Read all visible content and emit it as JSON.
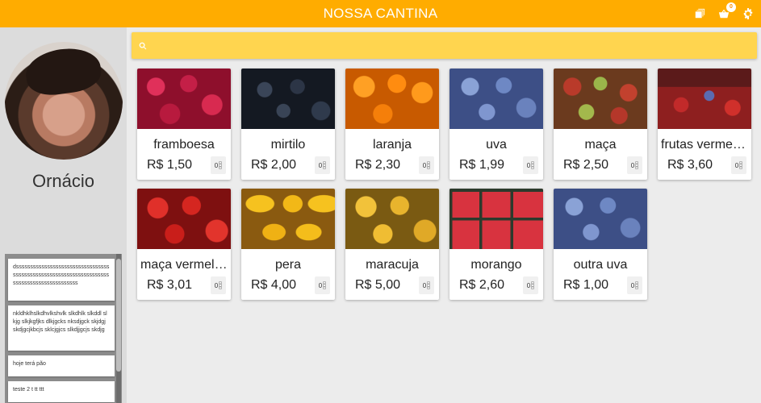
{
  "header": {
    "title": "NOSSA CANTINA",
    "cart_count": "0",
    "icons": [
      "history-icon",
      "cart-icon",
      "settings-icon"
    ]
  },
  "sidebar": {
    "user_name": "Ornácio",
    "notes": [
      "dssssssssssssssssssssssssssssssssssssssssssssssssssssssssssssssssssssssssssssssssssssssssss",
      "nkldhklhslkdhvlkshvlk slkdhlk slkddl slkjg slkjkgfjks dlkjgcks nksdjgck skjdgj skdjgcjkbcjs sklcjgjcs slkdjjgcjs skdjg",
      "hoje terá pão",
      "teste 2 t tt ttt"
    ]
  },
  "search": {
    "placeholder": "",
    "value": ""
  },
  "colors": {
    "header": "#ffac00",
    "search_bar": "#ffd54f",
    "sidebar": "#dcdcdc",
    "background": "#ececec"
  },
  "products": [
    {
      "name": "framboesa",
      "price": "R$ 1,50",
      "qty": "0",
      "image": "raspberries"
    },
    {
      "name": "mirtilo",
      "price": "R$ 2,00",
      "qty": "0",
      "image": "dark blueberries"
    },
    {
      "name": "laranja",
      "price": "R$ 2,30",
      "qty": "0",
      "image": "oranges"
    },
    {
      "name": "uva",
      "price": "R$ 1,99",
      "qty": "0",
      "image": "blueberries"
    },
    {
      "name": "maça",
      "price": "R$ 2,50",
      "qty": "0",
      "image": "mixed apples"
    },
    {
      "name": "frutas vermelhas",
      "price": "R$ 3,60",
      "qty": "0",
      "image": "mixed berries"
    },
    {
      "name": "maça vermelha",
      "price": "R$ 3,01",
      "qty": "0",
      "image": "red apples"
    },
    {
      "name": "pera",
      "price": "R$ 4,00",
      "qty": "0",
      "image": "yellow pears"
    },
    {
      "name": "maracuja",
      "price": "R$ 5,00",
      "qty": "0",
      "image": "passion fruit"
    },
    {
      "name": "morango",
      "price": "R$ 2,60",
      "qty": "0",
      "image": "strawberry crates"
    },
    {
      "name": "outra uva",
      "price": "R$ 1,00",
      "qty": "0",
      "image": "blueberries"
    }
  ]
}
